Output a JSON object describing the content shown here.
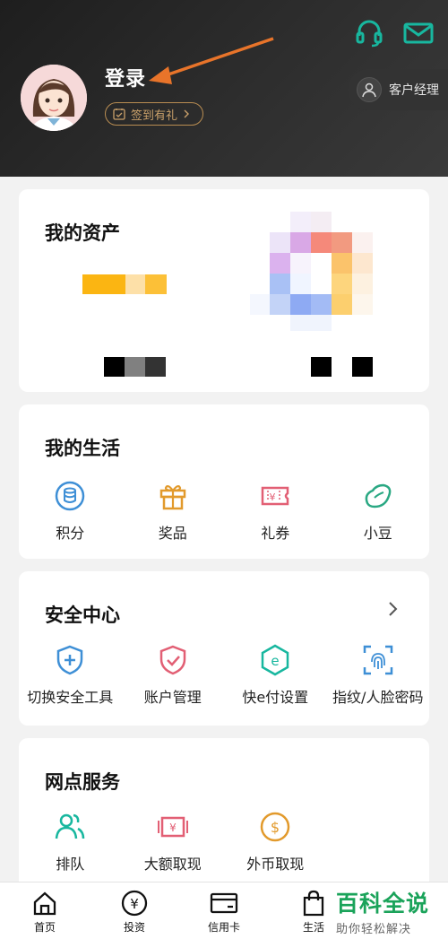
{
  "header": {
    "login_label": "登录",
    "checkin_label": "签到有礼",
    "account_manager_label": "客户经理"
  },
  "assets": {
    "title": "我的资产"
  },
  "life": {
    "title": "我的生活",
    "items": [
      {
        "label": "积分",
        "icon": "points-icon"
      },
      {
        "label": "奖品",
        "icon": "gift-icon"
      },
      {
        "label": "礼券",
        "icon": "coupon-icon"
      },
      {
        "label": "小豆",
        "icon": "bean-icon"
      }
    ]
  },
  "security": {
    "title": "安全中心",
    "items": [
      {
        "label": "切换安全工具",
        "icon": "shield-plus-icon"
      },
      {
        "label": "账户管理",
        "icon": "shield-check-icon"
      },
      {
        "label": "快e付设置",
        "icon": "e-pay-icon"
      },
      {
        "label": "指纹/人脸密码",
        "icon": "fingerprint-icon"
      }
    ]
  },
  "branch": {
    "title": "网点服务",
    "items": [
      {
        "label": "排队",
        "icon": "queue-icon"
      },
      {
        "label": "大额取现",
        "icon": "cash-withdraw-icon"
      },
      {
        "label": "外币取现",
        "icon": "foreign-currency-icon"
      }
    ]
  },
  "tabbar": {
    "items": [
      {
        "label": "首页",
        "icon": "home-icon"
      },
      {
        "label": "投资",
        "icon": "yuan-icon"
      },
      {
        "label": "信用卡",
        "icon": "credit-card-icon"
      },
      {
        "label": "生活",
        "icon": "shopping-bag-icon"
      }
    ]
  },
  "watermark": {
    "line1": "百科全说",
    "line2": "助你轻松解决"
  },
  "colors": {
    "accent_orange": "#e8742a",
    "teal": "#18b79f",
    "gold": "#c9a06a"
  }
}
